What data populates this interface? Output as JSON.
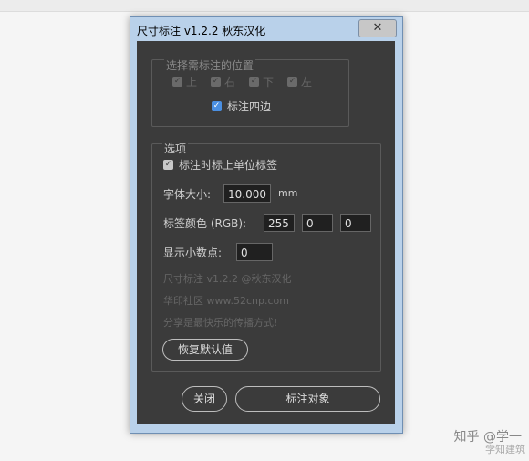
{
  "window": {
    "title": "尺寸标注 v1.2.2 秋东汉化",
    "close_glyph": "✕"
  },
  "position_group": {
    "legend": "选择需标注的位置",
    "sides": [
      {
        "label": "上"
      },
      {
        "label": "右"
      },
      {
        "label": "下"
      },
      {
        "label": "左"
      }
    ],
    "four_sides_label": "标注四边",
    "four_sides_checked": true
  },
  "options": {
    "legend": "选项",
    "unit_label": "标注时标上单位标签",
    "unit_checked": true,
    "font_size_label": "字体大小:",
    "font_size_value": "10.000",
    "font_size_unit": "mm",
    "color_label": "标签颜色 (RGB):",
    "color_r": "255",
    "color_g": "0",
    "color_b": "0",
    "decimals_label": "显示小数点:",
    "decimals_value": "0",
    "info_line1": "尺寸标注 v1.2.2 @秋东汉化",
    "info_line2": "华印社区  www.52cnp.com",
    "info_line3": "分享是最快乐的传播方式!",
    "reset_button": "恢复默认值"
  },
  "footer": {
    "close_button": "关闭",
    "submit_button": "标注对象"
  },
  "watermark": {
    "line1": "知乎 @学一",
    "line2": "学知建筑"
  },
  "colors": {
    "dialog_bg": "#3b3b3b",
    "accent": "#4a8fe2"
  }
}
